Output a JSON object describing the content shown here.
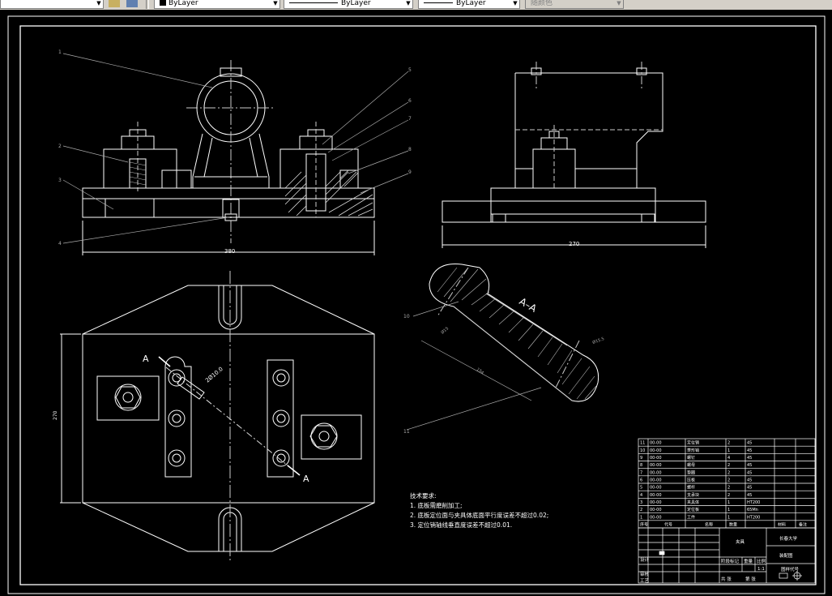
{
  "toolbar": {
    "layer_linetype_label": "ByLayer",
    "linetype_label": "ByLayer",
    "lineweight_label": "ByLayer",
    "color_label": "随颜色"
  },
  "drawing": {
    "view_dim_front": "380",
    "view_dim_side": "270",
    "view_dim_plan": "270",
    "section_label": "A–A",
    "section_marker_a1": "A",
    "section_marker_a2": "A",
    "dim_hole": "2Ø10.0",
    "part_numbers": [
      "1",
      "2",
      "3",
      "4",
      "5",
      "6",
      "7",
      "8",
      "9"
    ],
    "callout_10": "10",
    "callout_11": "11",
    "section_dim_1": "Ø15",
    "section_dim_2": "Ø15.5",
    "section_dim_3": "154",
    "tech_title": "技术要求:",
    "tech_req_1": "1. 底板需磨削加工;",
    "tech_req_2": "2. 底板定位面与夹具体底面平行度误差不超过0.02;",
    "tech_req_3": "3. 定位销轴线垂直度误差不超过0.01."
  },
  "bom": {
    "rows": [
      {
        "no": "11",
        "code": "00-00",
        "name": "定位销",
        "qty": "2",
        "mat": "45"
      },
      {
        "no": "10",
        "code": "00-00",
        "name": "菱形销",
        "qty": "1",
        "mat": "45"
      },
      {
        "no": "9",
        "code": "00-00",
        "name": "螺钉",
        "qty": "4",
        "mat": "45"
      },
      {
        "no": "8",
        "code": "00-00",
        "name": "螺母",
        "qty": "2",
        "mat": "45"
      },
      {
        "no": "7",
        "code": "00-00",
        "name": "垫圈",
        "qty": "2",
        "mat": "45"
      },
      {
        "no": "6",
        "code": "00-00",
        "name": "压板",
        "qty": "2",
        "mat": "45"
      },
      {
        "no": "5",
        "code": "00-00",
        "name": "螺杆",
        "qty": "2",
        "mat": "45"
      },
      {
        "no": "4",
        "code": "00-00",
        "name": "支承块",
        "qty": "2",
        "mat": "45"
      },
      {
        "no": "3",
        "code": "00-00",
        "name": "夹具体",
        "qty": "1",
        "mat": "HT200"
      },
      {
        "no": "2",
        "code": "00-00",
        "name": "定位板",
        "qty": "1",
        "mat": "65Mn"
      },
      {
        "no": "1",
        "code": "00-00",
        "name": "工件",
        "qty": "1",
        "mat": "HT200"
      }
    ],
    "header": [
      "序号",
      "代号",
      "名称",
      "数量",
      "材料",
      "备注"
    ],
    "title_block": {
      "part_name": "夹具",
      "school": "长春大学",
      "drawing_type": "装配图",
      "designer_label": "设计",
      "checker_label": "审核",
      "approve_label": "工艺",
      "stage_label": "阶段标记",
      "weight_label": "重量",
      "scale_label": "比例",
      "scale_value": "1:1",
      "sheet_label": "共 张",
      "sheet_of_label": "第 张",
      "drawing_no": "图样代号"
    }
  }
}
